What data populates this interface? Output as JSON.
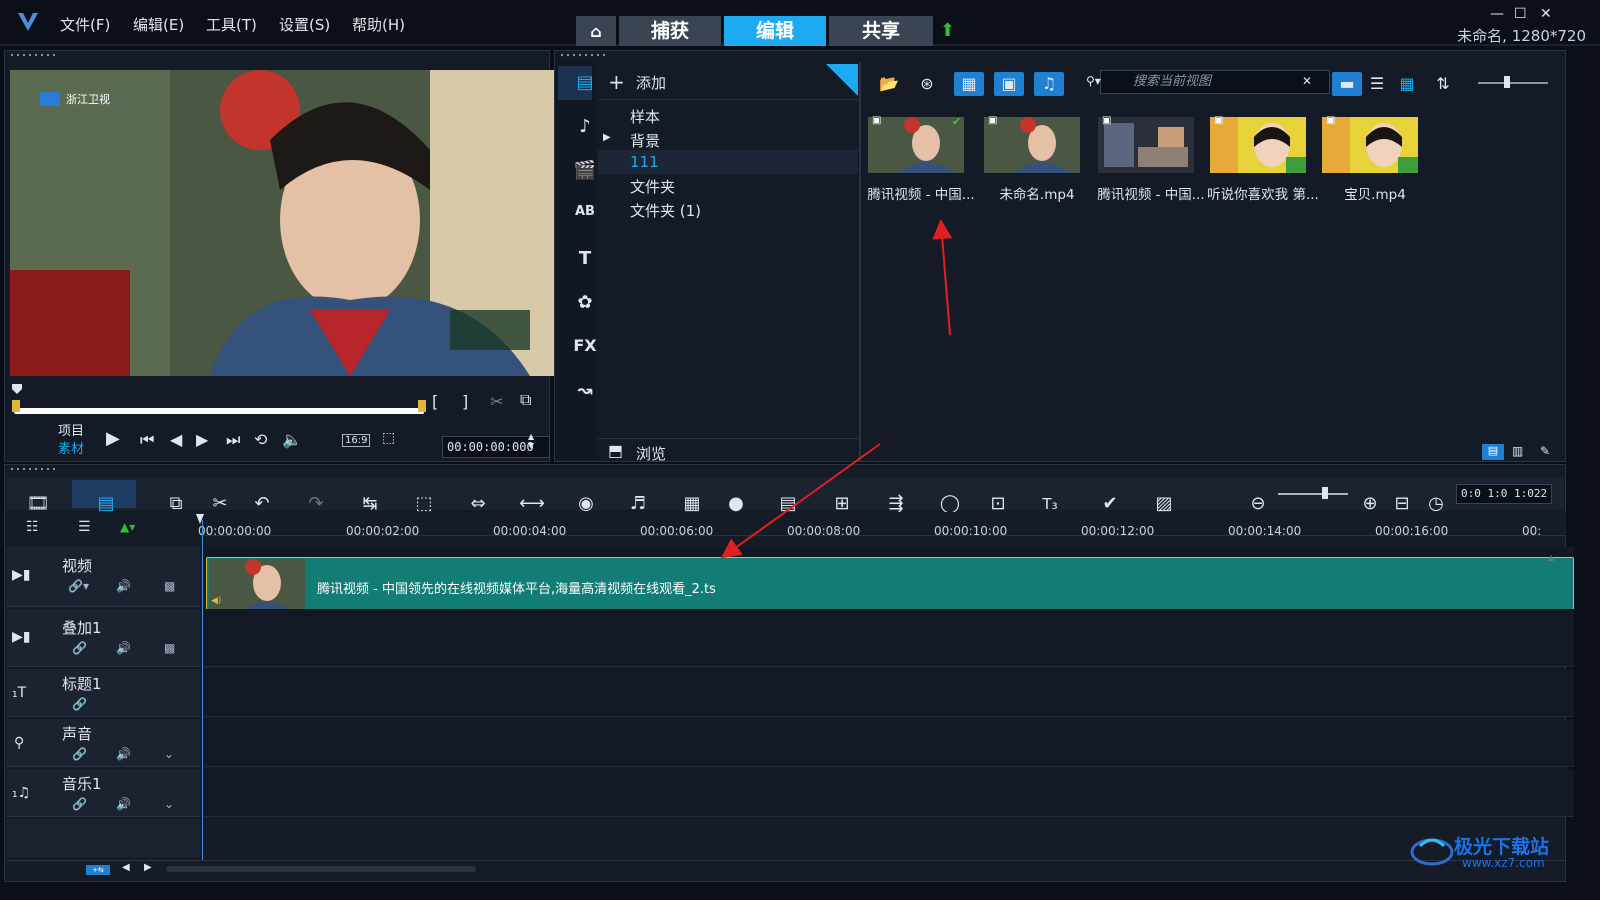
{
  "menu": [
    "文件(F)",
    "编辑(E)",
    "工具(T)",
    "设置(S)",
    "帮助(H)"
  ],
  "nav_tabs": [
    "捕获",
    "编辑",
    "共享"
  ],
  "project_info": "未命名, 1280*720",
  "player": {
    "mode_project": "项目",
    "mode_clip": "素材",
    "aspect": "16:9",
    "timecode": "00:00:00:000",
    "mark_in": "[",
    "mark_out": "]"
  },
  "library": {
    "add_label": "添加",
    "browse_label": "浏览",
    "tree": [
      "样本",
      "背景",
      "111",
      "文件夹",
      "文件夹 (1)"
    ],
    "selected_tree_item": "111",
    "search_placeholder": "搜索当前视图",
    "thumbnails": [
      {
        "caption": "腾讯视频 - 中国...",
        "checked": true
      },
      {
        "caption": "未命名.mp4",
        "checked": false
      },
      {
        "caption": "腾讯视频 - 中国...",
        "checked": false
      },
      {
        "caption": "听说你喜欢我 第...",
        "checked": false
      },
      {
        "caption": "宝贝.mp4",
        "checked": false
      }
    ],
    "sidebar_fx": "FX"
  },
  "timeline": {
    "ruler": [
      "00:00:00:00",
      "00:00:02:00",
      "00:00:04:00",
      "00:00:06:00",
      "00:00:08:00",
      "00:00:10:00",
      "00:00:12:00",
      "00:00:14:00",
      "00:00:16:00",
      "00:"
    ],
    "duration": "0:0 1:0 1:022",
    "tracks": [
      "视频",
      "叠加1",
      "标题1",
      "声音",
      "音乐1"
    ],
    "clip_label": "腾讯视频 - 中国领先的在线视频媒体平台,海量高清视频在线观看_2.ts"
  },
  "watermark": {
    "brand": "极光下载站",
    "url": "www.xz7.com"
  },
  "colors": {
    "accent": "#1eaaf0",
    "clip": "#127d74",
    "arrow": "#e02020",
    "bg": "#141a26"
  }
}
